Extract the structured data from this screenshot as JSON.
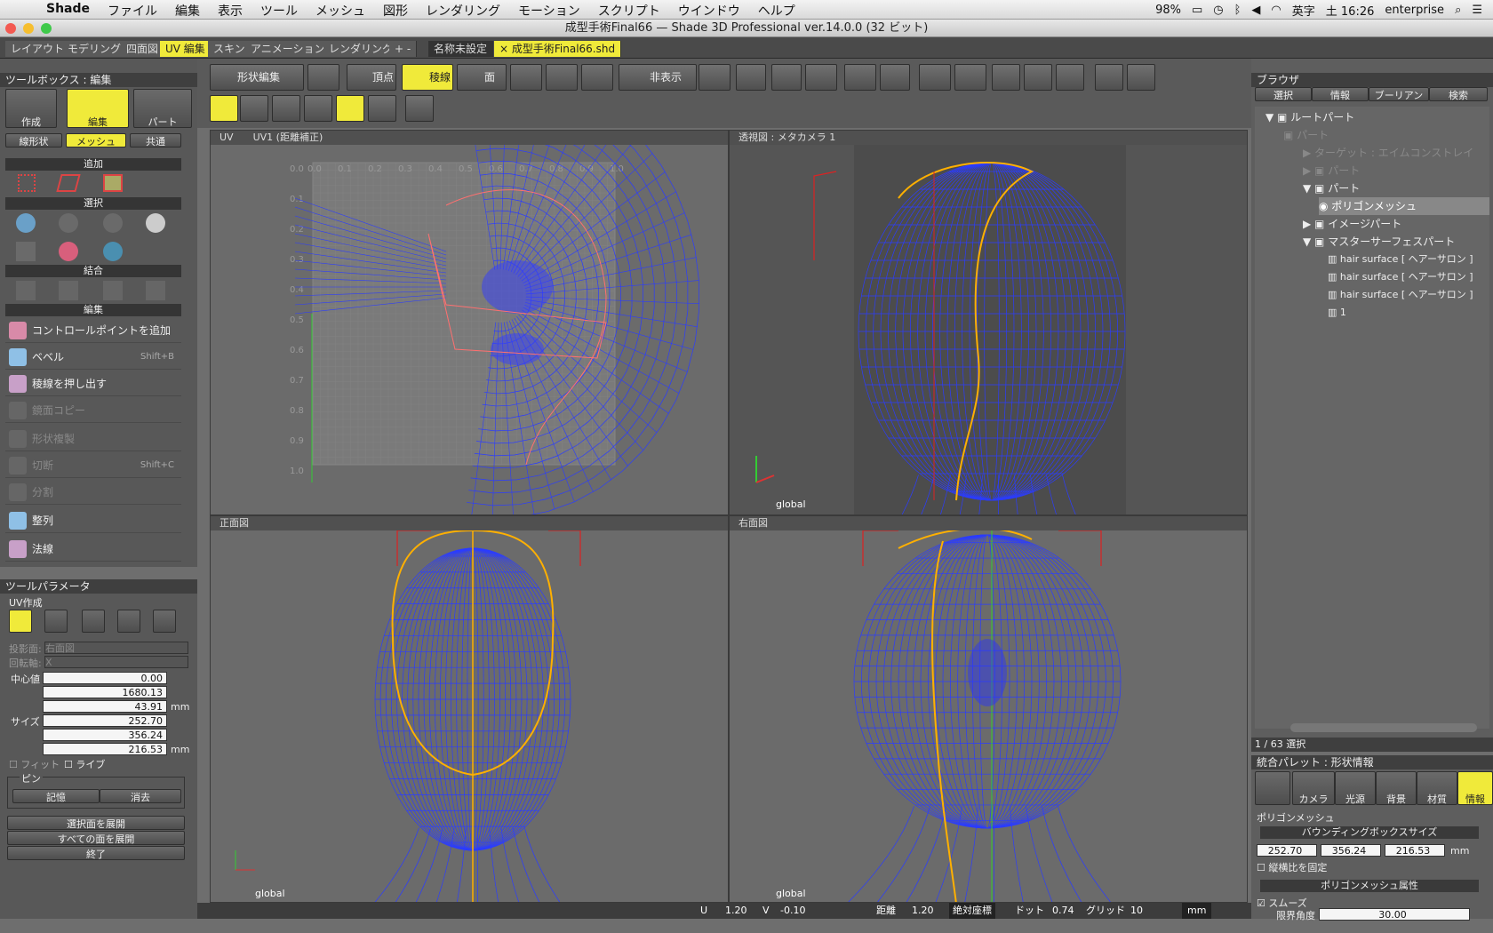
{
  "menubar": {
    "app": "Shade",
    "items": [
      "ファイル",
      "編集",
      "表示",
      "ツール",
      "メッシュ",
      "図形",
      "レンダリング",
      "モーション",
      "スクリプト",
      "ウインドウ",
      "ヘルプ"
    ],
    "battery": "98%",
    "input": "英字",
    "clock": "土 16:26",
    "user": "enterprise"
  },
  "window": {
    "title": "成型手術Final66 — Shade 3D Professional ver.14.0.0 (32 ビット)"
  },
  "layout_tabs": [
    "レイアウト",
    "モデリング",
    "四面図",
    "UV 編集",
    "スキン",
    "アニメーション",
    "レンダリング",
    "+ -"
  ],
  "doc_tabs": [
    "名称未設定",
    "× 成型手術Final66.shd"
  ],
  "toolbar": {
    "shape_edit": "形状編集",
    "vertex": "頂点",
    "edge": "稜線",
    "face": "面",
    "hide": "非表示"
  },
  "toolbox": {
    "title": "ツールボックス : 編集",
    "modes": [
      "作成",
      "編集",
      "パート"
    ],
    "subtabs": [
      "線形状",
      "メッシュ",
      "共通"
    ],
    "sections": {
      "add": "追加",
      "select": "選択",
      "combine": "結合",
      "edit": "編集"
    },
    "tools": [
      {
        "label": "コントロールポイントを追加",
        "shortcut": ""
      },
      {
        "label": "ベベル",
        "shortcut": "Shift+B"
      },
      {
        "label": "稜線を押し出す",
        "shortcut": ""
      },
      {
        "label": "鏡面コピー",
        "shortcut": ""
      },
      {
        "label": "形状複製",
        "shortcut": ""
      },
      {
        "label": "切断",
        "shortcut": "Shift+C"
      },
      {
        "label": "分割",
        "shortcut": ""
      },
      {
        "label": "整列",
        "shortcut": ""
      },
      {
        "label": "法線",
        "shortcut": ""
      }
    ]
  },
  "params": {
    "title": "ツールパラメータ",
    "group": "UV作成",
    "projection_label": "投影面:",
    "projection": "右面図",
    "rotation_label": "回転軸:",
    "rotation": "X",
    "center_label": "中心値",
    "center": [
      "0.00",
      "1680.13",
      "43.91"
    ],
    "size_label": "サイズ",
    "size": [
      "252.70",
      "356.24",
      "216.53"
    ],
    "unit": "mm",
    "fit": "フィット",
    "live": "ライブ",
    "pin": "ピン",
    "memo": "記憶",
    "erase": "消去",
    "expand_selected": "選択面を展開",
    "expand_all": "すべての面を展開",
    "finish": "終了"
  },
  "viewports": {
    "uv": {
      "label": "UV",
      "map": "UV1 (距離補正)",
      "ticks_x": [
        "0.0",
        "0.1",
        "0.2",
        "0.3",
        "0.4",
        "0.5",
        "0.6",
        "0.7",
        "0.8",
        "0.9",
        "1.0"
      ],
      "ticks_y": [
        "0.0",
        "0.1",
        "0.2",
        "0.3",
        "0.4",
        "0.5",
        "0.6",
        "0.7",
        "0.8",
        "0.9",
        "1.0"
      ]
    },
    "persp": {
      "label": "透視図 : メタカメラ 1",
      "coord": "global"
    },
    "front": {
      "label": "正面図",
      "coord": "global"
    },
    "right": {
      "label": "右面図",
      "coord": "global"
    }
  },
  "browser": {
    "title": "ブラウザ",
    "tabs": [
      "選択",
      "情報",
      "ブーリアン",
      "検索"
    ],
    "tree": [
      "ルートパート",
      "パート",
      "ターゲット : エイムコンストレイ",
      "パート",
      "パート",
      "ポリゴンメッシュ",
      "イメージパート",
      "マスターサーフェスパート",
      "hair surface [ ヘアーサロン ]",
      "hair surface [ ヘアーサロン ]",
      "hair surface [ ヘアーサロン ]",
      "1"
    ],
    "count": "1 / 63 選択"
  },
  "palette": {
    "title": "統合パレット : 形状情報",
    "tabs": [
      "カメラ",
      "光源",
      "背景",
      "材質",
      "情報"
    ],
    "object": "ポリゴンメッシュ",
    "bbox_title": "バウンディングボックスサイズ",
    "bbox": [
      "252.70",
      "356.24",
      "216.53"
    ],
    "unit": "mm",
    "keep_ratio": "縦横比を固定",
    "attr_title": "ポリゴンメッシュ属性",
    "smooth": "スムーズ",
    "limit_label": "限界角度",
    "limit": "30.00"
  },
  "statusbar": {
    "u_label": "U",
    "u": "1.20",
    "v_label": "V",
    "v": "-0.10",
    "dist_label": "距離",
    "dist": "1.20",
    "coord_mode": "絶対座標",
    "dot_label": "ドット",
    "dot": "0.74",
    "grid_label": "グリッド",
    "grid": "10",
    "unit": "mm"
  },
  "colors": {
    "accent": "#f0ea3a",
    "wire": "#2b3cff",
    "seam": "#ffb000",
    "uvborder": "#ff7070"
  }
}
